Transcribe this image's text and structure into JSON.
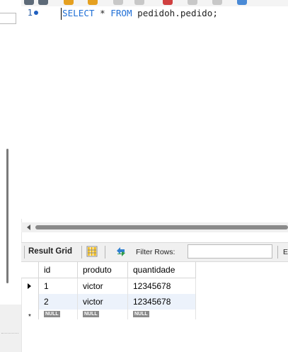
{
  "editor": {
    "line_number": "1",
    "sql_select": "SELECT",
    "sql_star": " * ",
    "sql_from": "FROM",
    "sql_rest": " pedidoh.pedido;"
  },
  "result_toolbar": {
    "result_grid_label": "Result Grid",
    "filter_label": "Filter Rows:",
    "filter_value": "",
    "export_label": "E"
  },
  "grid": {
    "columns": [
      "id",
      "produto",
      "quantidade"
    ],
    "rows": [
      [
        "1",
        "victor",
        "12345678"
      ],
      [
        "2",
        "victor",
        "12345678"
      ]
    ],
    "new_row": [
      "NULL",
      "NULL",
      "NULL"
    ],
    "new_row_marker": "*"
  },
  "icons": {
    "grid": "grid-layout-icon",
    "refresh": "refresh-icon",
    "row_pointer": "row-pointer-arrow-icon"
  },
  "colors": {
    "keyword": "#1f6fd6",
    "line_dot": "#1f5fbf",
    "alt_row": "#ecf2fb",
    "null_badge": "#8a8a8a"
  }
}
